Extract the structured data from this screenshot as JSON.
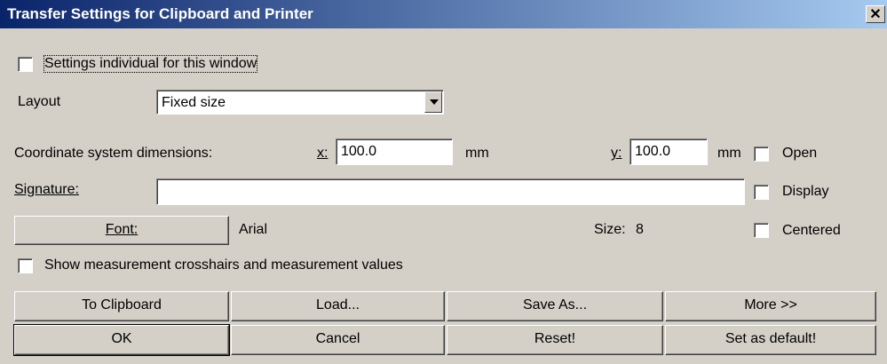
{
  "window": {
    "title": "Transfer Settings for Clipboard and Printer",
    "close_glyph": "✕"
  },
  "individual": {
    "label": "Settings individual for this window",
    "checked": false
  },
  "layout": {
    "label": "Layout",
    "value": "Fixed size"
  },
  "coords": {
    "label": "Coordinate system dimensions:",
    "x_label": "x:",
    "x_value": "100.0",
    "x_unit": "mm",
    "y_label": "y:",
    "y_value": "100.0",
    "y_unit": "mm"
  },
  "signature": {
    "label": "Signature:",
    "value": ""
  },
  "font": {
    "button_label": "Font:",
    "name": "Arial",
    "size_label": "Size:",
    "size_value": "8"
  },
  "options": {
    "open": "Open",
    "display": "Display",
    "centered": "Centered"
  },
  "crosshairs": {
    "label": "Show measurement crosshairs and measurement values"
  },
  "buttons": {
    "to_clipboard": "To Clipboard",
    "load": "Load...",
    "save_as": "Save As...",
    "more": "More >>",
    "ok": "OK",
    "cancel": "Cancel",
    "reset": "Reset!",
    "set_default": "Set as default!"
  }
}
